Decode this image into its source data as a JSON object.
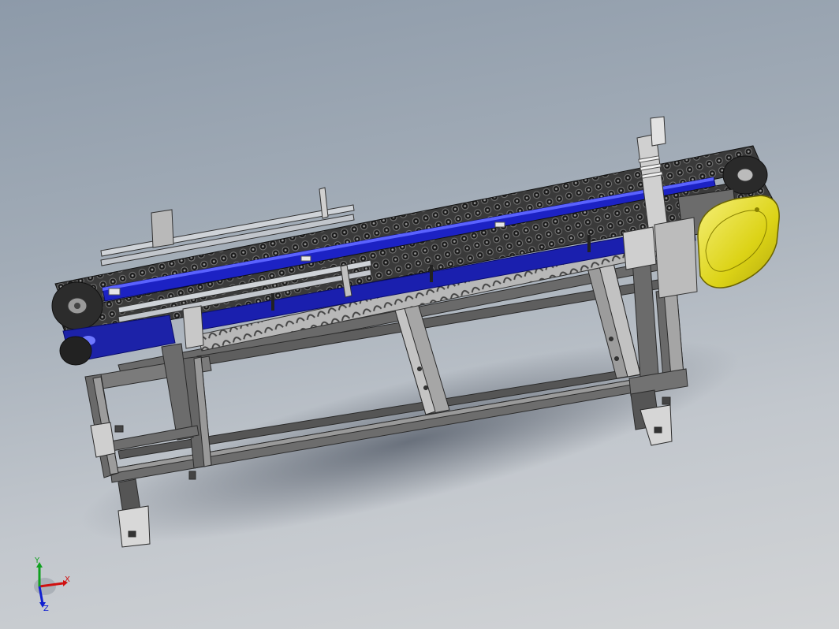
{
  "viewport": {
    "background_top": "#8d9aa9",
    "background_bottom": "#d2d4d6"
  },
  "model": {
    "frame_color": "#5b5b5b",
    "frame_highlight": "#8a8a8a",
    "chain_color": "#2a2a2a",
    "rail_color": "#1a1fc8",
    "guard_color": "#e3df1c",
    "bracket_color": "#c9c9c9"
  },
  "triad": {
    "x_label": "X",
    "y_label": "Y",
    "z_label": "Z",
    "x_color": "#d01010",
    "y_color": "#10a020",
    "z_color": "#1020d0"
  }
}
